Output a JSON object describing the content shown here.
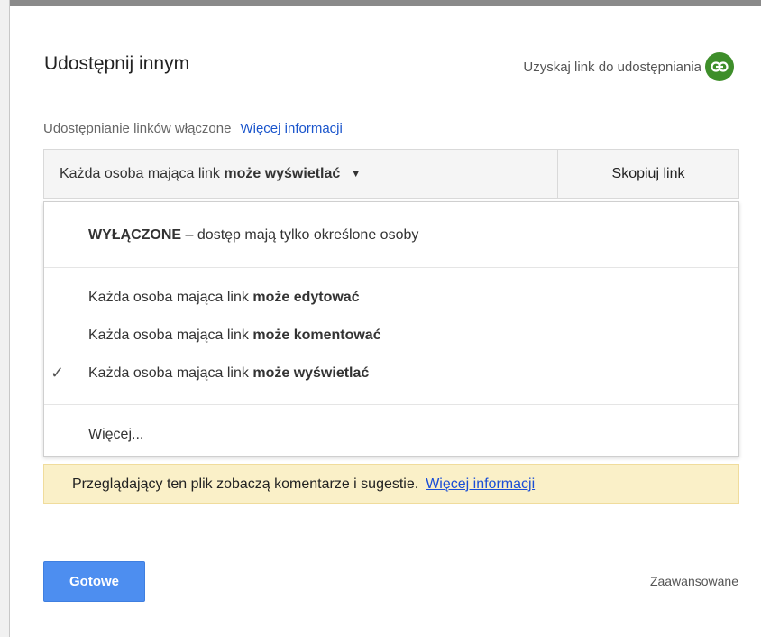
{
  "dialog": {
    "title": "Udostępnij innym",
    "get_link_label": "Uzyskaj link do udostępniania",
    "link_icon": "link-icon",
    "accent_color": "#3e8e2a"
  },
  "link_sharing": {
    "status": "Udostępnianie linków włączone",
    "more_info": "Więcej informacji",
    "selected_prefix": "Każda osoba mająca link",
    "selected_bold": "może wyświetlać",
    "copy_label": "Skopiuj link"
  },
  "menu": {
    "off_bold": "WYŁĄCZONE",
    "off_rest": " – dostęp mają tylko określone osoby",
    "items": [
      {
        "prefix": "Każda osoba mająca link",
        "bold": "może edytować",
        "checked": false
      },
      {
        "prefix": "Każda osoba mająca link",
        "bold": "może komentować",
        "checked": false
      },
      {
        "prefix": "Każda osoba mająca link",
        "bold": "może wyświetlać",
        "checked": true
      }
    ],
    "more": "Więcej..."
  },
  "notice": {
    "text": "Przeglądający ten plik zobaczą komentarze i sugestie.",
    "link": "Więcej informacji",
    "background": "#faf0c8"
  },
  "footer": {
    "done": "Gotowe",
    "advanced": "Zaawansowane",
    "done_color": "#4d8ef0"
  }
}
